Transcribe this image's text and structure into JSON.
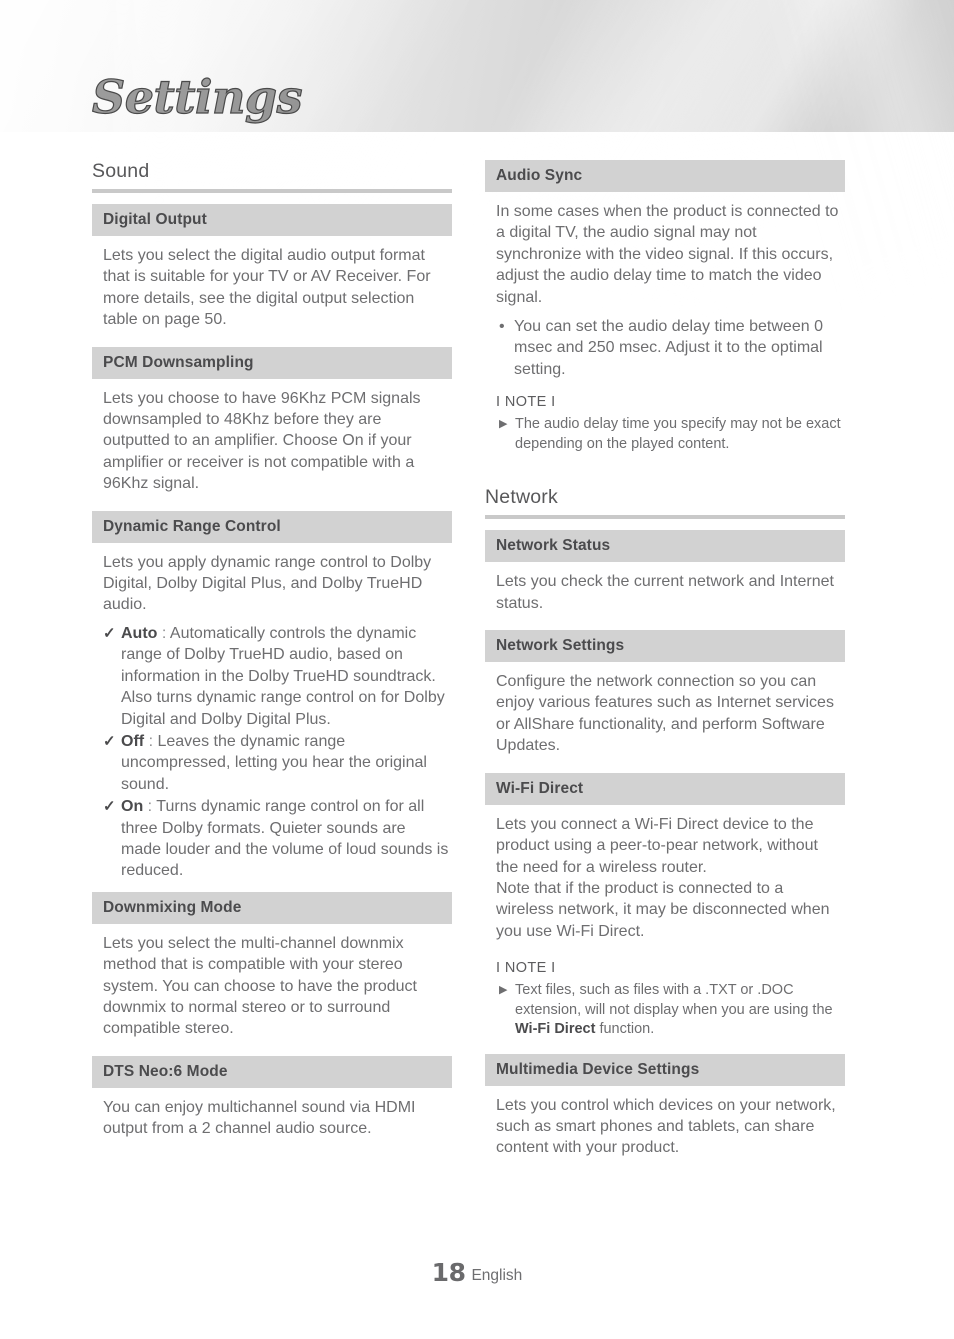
{
  "document": {
    "title": "Settings",
    "page_number": "18",
    "language": "English"
  },
  "left_column": {
    "sections": [
      {
        "heading": "Sound",
        "items": [
          {
            "subheading": "Digital Output",
            "paragraphs": [
              "Lets you select the digital audio output format that is suitable for your TV or AV Receiver. For more details, see the digital output selection table on page 50."
            ]
          },
          {
            "subheading": "PCM Downsampling",
            "paragraphs": [
              "Lets you choose to have 96Khz PCM signals downsampled to 48Khz before they are outputted to an amplifier. Choose On if your amplifier or receiver is not compatible with a 96Khz signal."
            ]
          },
          {
            "subheading": "Dynamic Range Control",
            "paragraphs": [
              "Lets you apply dynamic range control to Dolby Digital, Dolby Digital Plus, and Dolby TrueHD audio."
            ],
            "check_items": [
              {
                "term": "Auto",
                "separator": ":",
                "text": "Automatically controls the dynamic range of Dolby TrueHD audio, based on information in the Dolby TrueHD soundtrack. Also turns dynamic range control on for Dolby Digital and Dolby Digital Plus."
              },
              {
                "term": "Off",
                "separator": ":",
                "text": "Leaves the dynamic range uncompressed, letting you hear the original sound."
              },
              {
                "term": "On",
                "separator": ":",
                "text": "Turns dynamic range control on for all three Dolby formats. Quieter sounds are made louder and the volume of loud sounds is reduced."
              }
            ]
          },
          {
            "subheading": "Downmixing Mode",
            "paragraphs": [
              "Lets you select the multi-channel downmix method that is compatible with your stereo system. You can choose to have the product downmix to normal stereo or to surround compatible stereo."
            ]
          },
          {
            "subheading": "DTS Neo:6 Mode",
            "paragraphs": [
              "You can enjoy multichannel sound via HDMI output from a 2 channel audio source."
            ]
          }
        ]
      }
    ]
  },
  "right_column": {
    "audio_sync": {
      "subheading": "Audio Sync",
      "paragraphs": [
        "In some cases when the product is connected to a digital TV, the audio signal may not synchronize with the video signal. If this occurs, adjust the audio delay time to match the video signal."
      ],
      "bullets": [
        "You can set the audio delay time between 0 msec and 250 msec. Adjust it to the optimal setting."
      ],
      "note": {
        "label": "I NOTE I",
        "items": [
          {
            "prefix": "The audio delay time you specify may not be exact depending on the played content.",
            "bold": "",
            "suffix": ""
          }
        ]
      }
    },
    "network": {
      "heading": "Network",
      "items": [
        {
          "subheading": "Network Status",
          "paragraphs": [
            "Lets you check the current network and Internet status."
          ]
        },
        {
          "subheading": "Network Settings",
          "paragraphs": [
            "Configure the network connection so you can enjoy various features such as Internet services or AllShare functionality, and perform Software Updates."
          ]
        },
        {
          "subheading": "Wi-Fi Direct",
          "paragraphs": [
            "Lets you connect a Wi-Fi Direct device to the product using a peer-to-pear network, without the need for a wireless router.",
            "Note that if the product is connected to a wireless network, it may be disconnected when you use Wi-Fi Direct."
          ],
          "note": {
            "label": "I NOTE I",
            "items": [
              {
                "prefix": "Text files, such as files with a .TXT or .DOC extension, will not display when you are using the ",
                "bold": "Wi-Fi Direct",
                "suffix": " function."
              }
            ]
          }
        },
        {
          "subheading": "Multimedia Device Settings",
          "paragraphs": [
            "Lets you control which devices on your network, such as smart phones and tablets, can share content with your product."
          ]
        }
      ]
    }
  },
  "colors": {
    "subbar_bg": "#d2d2d2",
    "rule": "#c9c9c9",
    "body_text": "#6e6e70",
    "heading_text": "#4b4b4d"
  }
}
